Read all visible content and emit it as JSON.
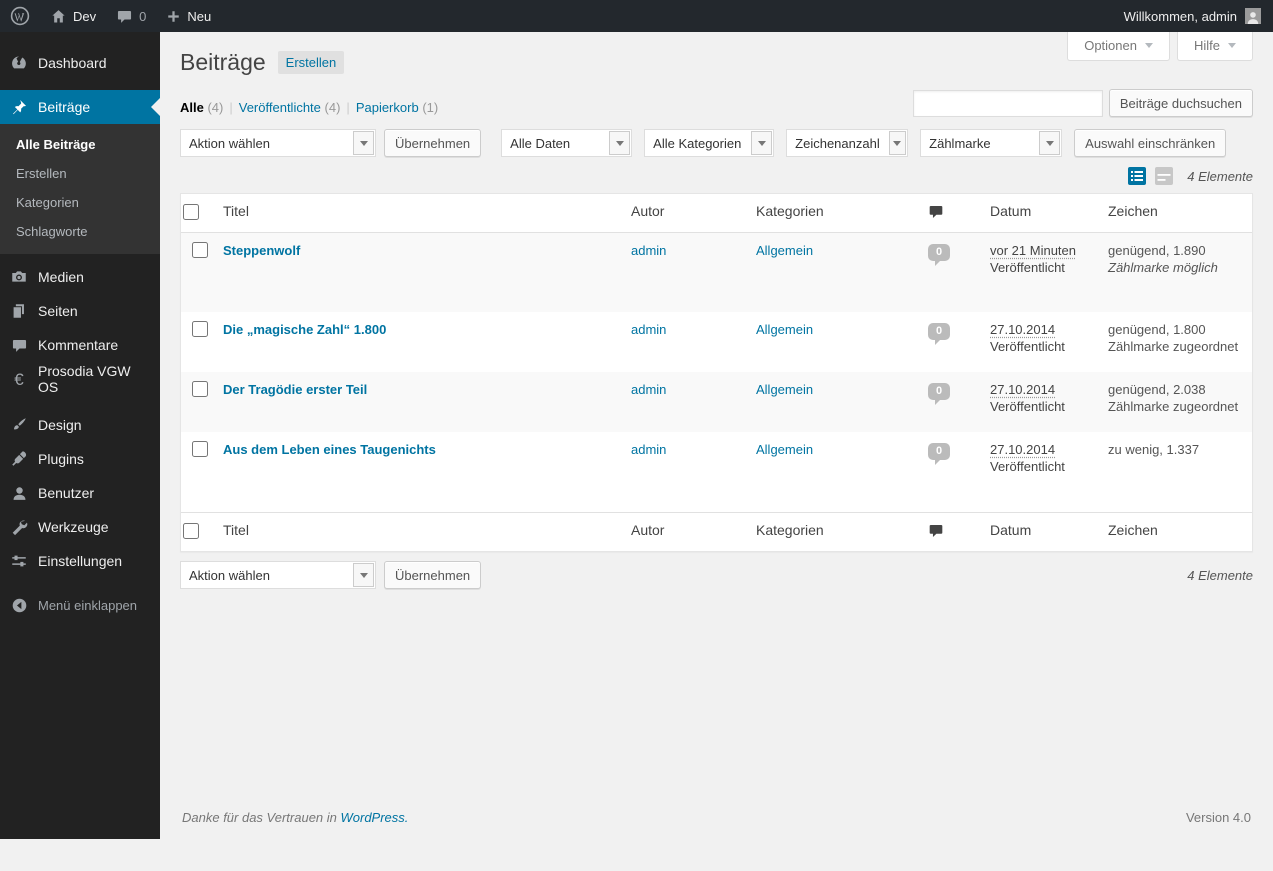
{
  "colors": {
    "accent": "#0074a2",
    "admin_bar_bg": "#23282d",
    "sidebar_bg": "#222222",
    "submenu_bg": "#333333",
    "content_bg": "#f1f1f1",
    "link": "#0074a2",
    "comment_bubble": "#bbbbbb"
  },
  "admin_bar": {
    "site_name": "Dev",
    "comment_count": "0",
    "new_label": "Neu",
    "greeting": "Willkommen, admin"
  },
  "screen_meta": {
    "options_label": "Optionen",
    "help_label": "Hilfe"
  },
  "sidebar": {
    "dashboard": "Dashboard",
    "posts": "Beiträge",
    "posts_submenu": {
      "all": "Alle Beiträge",
      "new": "Erstellen",
      "categories": "Kategorien",
      "tags": "Schlagworte"
    },
    "media": "Medien",
    "pages": "Seiten",
    "comments": "Kommentare",
    "prosodia": "Prosodia VGW OS",
    "design": "Design",
    "plugins": "Plugins",
    "users": "Benutzer",
    "tools": "Werkzeuge",
    "settings": "Einstellungen",
    "collapse": "Menü einklappen"
  },
  "page": {
    "title": "Beiträge",
    "add_new": "Erstellen",
    "views": {
      "all": {
        "label": "Alle",
        "count": "(4)"
      },
      "published": {
        "label": "Veröffentlichte",
        "count": "(4)"
      },
      "trash": {
        "label": "Papierkorb",
        "count": "(1)"
      }
    },
    "search_button": "Beiträge duchsuchen",
    "bulk": {
      "action_select": "Aktion wählen",
      "apply": "Übernehmen"
    },
    "filters": {
      "dates": "Alle Daten",
      "categories": "Alle Kategorien",
      "chars": "Zeichenanzahl",
      "counter": "Zählmarke",
      "apply": "Auswahl einschränken"
    },
    "item_count": "4 Elemente"
  },
  "table": {
    "columns": {
      "title": "Titel",
      "author": "Autor",
      "categories": "Kategorien",
      "date": "Datum",
      "chars": "Zeichen"
    },
    "rows": [
      {
        "title": "Steppenwolf",
        "author": "admin",
        "category": "Allgemein",
        "comments": "0",
        "date": "vor 21 Minuten",
        "status": "Veröffentlicht",
        "chars": "genügend, 1.890",
        "chars_note": "Zählmarke möglich"
      },
      {
        "title": "Die „magische Zahl“ 1.800",
        "author": "admin",
        "category": "Allgemein",
        "comments": "0",
        "date": "27.10.2014",
        "status": "Veröffentlicht",
        "chars": "genügend, 1.800",
        "chars_note": "Zählmarke zugeordnet"
      },
      {
        "title": "Der Tragödie erster Teil",
        "author": "admin",
        "category": "Allgemein",
        "comments": "0",
        "date": "27.10.2014",
        "status": "Veröffentlicht",
        "chars": "genügend, 2.038",
        "chars_note": "Zählmarke zugeordnet"
      },
      {
        "title": "Aus dem Leben eines Taugenichts",
        "author": "admin",
        "category": "Allgemein",
        "comments": "0",
        "date": "27.10.2014",
        "status": "Veröffentlicht",
        "chars": "zu wenig, 1.337",
        "chars_note": ""
      }
    ]
  },
  "footer": {
    "thanks": "Danke für das Vertrauen in ",
    "wordpress_link": "WordPress.",
    "version": "Version 4.0"
  }
}
